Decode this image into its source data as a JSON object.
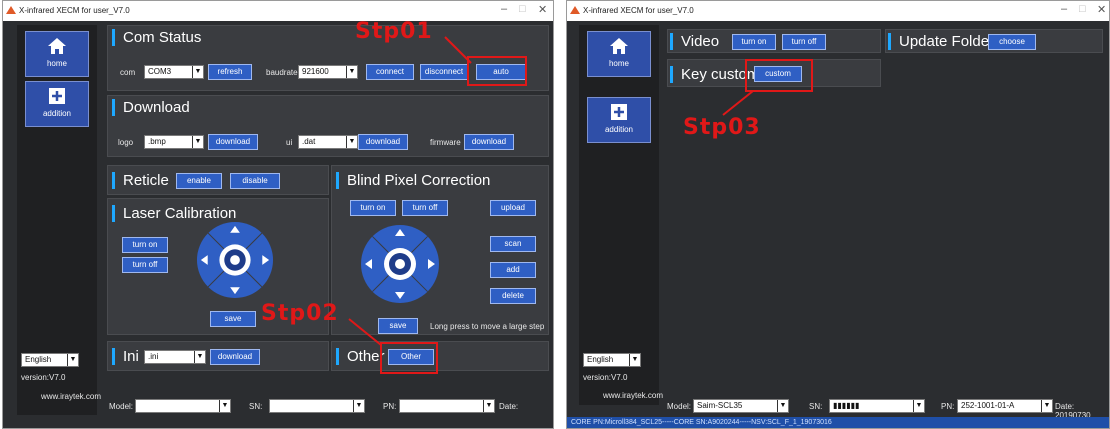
{
  "left": {
    "title": "X-infrared XECM for user_V7.0",
    "nav": {
      "home": "home",
      "addition": "addition"
    },
    "language": "English",
    "version": "version:V7.0",
    "website": "www.iraytek.com",
    "com": {
      "title": "Com Status",
      "com_label": "com",
      "com_value": "COM3",
      "refresh": "refresh",
      "baud_label": "baudrate",
      "baud_value": "921600",
      "connect": "connect",
      "disconnect": "disconnect",
      "auto": "auto"
    },
    "download": {
      "title": "Download",
      "logo_label": "logo",
      "logo_value": ".bmp",
      "download": "download",
      "ui_label": "ui",
      "ui_value": ".dat",
      "firmware_label": "firmware"
    },
    "reticle": {
      "title": "Reticle",
      "enable": "enable",
      "disable": "disable"
    },
    "laser": {
      "title": "Laser Calibration",
      "turn_on": "turn on",
      "turn_off": "turn off",
      "save": "save"
    },
    "blind": {
      "title": "Blind Pixel Correction",
      "turn_on": "turn on",
      "turn_off": "turn off",
      "upload": "upload",
      "scan": "scan",
      "add": "add",
      "delete": "delete",
      "save": "save",
      "hint": "Long press to move a large step"
    },
    "ini": {
      "title": "Ini",
      "value": ".ini",
      "download": "download"
    },
    "other": {
      "title": "Other",
      "button": "Other"
    },
    "footer": {
      "model": "Model:",
      "sn": "SN:",
      "pn": "PN:",
      "date": "Date:"
    }
  },
  "right": {
    "title": "X-infrared XECM for user_V7.0",
    "nav": {
      "home": "home",
      "addition": "addition"
    },
    "language": "English",
    "version": "version:V7.0",
    "website": "www.iraytek.com",
    "video": {
      "title": "Video",
      "turn_on": "turn on",
      "turn_off": "turn off"
    },
    "update": {
      "title": "Update Folder",
      "choose": "choose"
    },
    "key": {
      "title": "Key custom",
      "custom": "custom"
    },
    "footer": {
      "model_label": "Model:",
      "model_value": "Saim-SCL35",
      "sn_label": "SN:",
      "sn_value": "▮▮▮▮▮▮",
      "pn_label": "PN:",
      "pn_value": "252-1001-01-A",
      "date": "Date: 20190730"
    },
    "status": "CORE PN:Microll384_SCL25-----CORE SN:A9020244-----NSV:SCL_F_1_19073016"
  },
  "steps": {
    "s1": "Stp01",
    "s2": "Stp02",
    "s3": "Stp03"
  },
  "colors": {
    "accent": "#1ea8ff",
    "button": "#2f5fc4",
    "highlight": "#e01818"
  }
}
